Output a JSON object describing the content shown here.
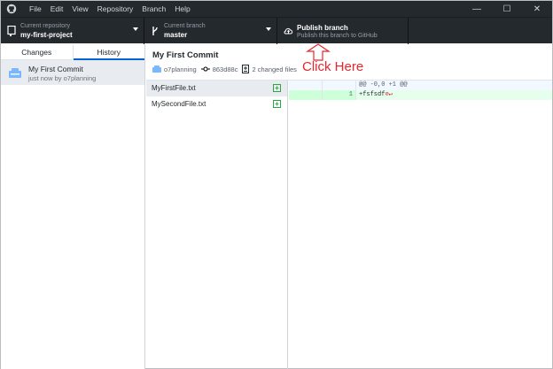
{
  "window": {
    "menu": [
      {
        "label": "File"
      },
      {
        "label": "Edit"
      },
      {
        "label": "View"
      },
      {
        "label": "Repository"
      },
      {
        "label": "Branch"
      },
      {
        "label": "Help"
      }
    ],
    "controls": {
      "minimize": "—",
      "maximize": "☐",
      "close": "✕"
    }
  },
  "toolbar": {
    "repo": {
      "sub": "Current repository",
      "main": "my-first-project"
    },
    "branch": {
      "sub": "Current branch",
      "main": "master"
    },
    "publish": {
      "main": "Publish branch",
      "sub": "Publish this branch to GitHub"
    }
  },
  "sidebar": {
    "tabs": [
      {
        "label": "Changes"
      },
      {
        "label": "History"
      }
    ],
    "commit": {
      "title": "My First Commit",
      "sub": "just now by o7planning"
    }
  },
  "detail": {
    "title": "My First Commit",
    "author": "o7planning",
    "sha": "863d88c",
    "changed": "2 changed files"
  },
  "annotation": {
    "text": "Click Here"
  },
  "files": [
    {
      "name": "MyFirstFile.txt",
      "status": "+"
    },
    {
      "name": "MySecondFile.txt",
      "status": "+"
    }
  ],
  "diff": {
    "hunk": "@@ -0,0 +1 @@",
    "line_no": "1",
    "line": "+fsfsdf",
    "nl_mark": "⊘↵"
  }
}
